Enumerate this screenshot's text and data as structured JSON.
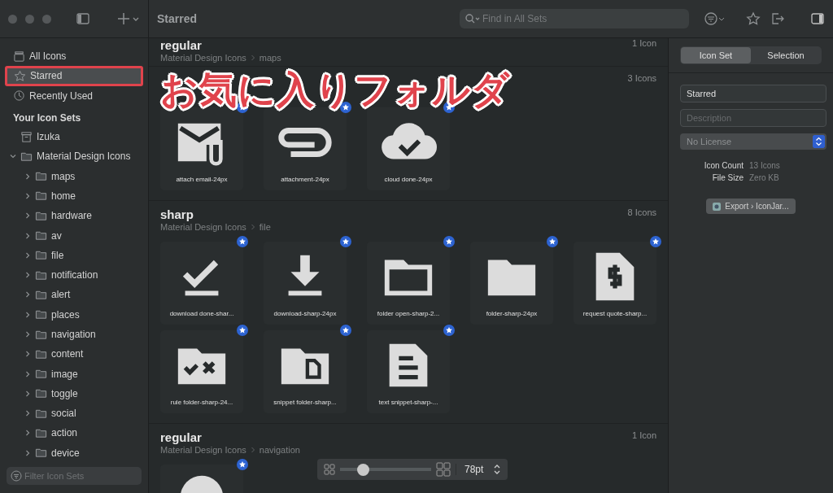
{
  "toolbar": {
    "title": "Starred",
    "search": {
      "placeholder": "Find in All Sets"
    }
  },
  "sidebar": {
    "library": [
      {
        "label": "All Icons",
        "kind": "all",
        "selected": false,
        "highlighted": false
      },
      {
        "label": "Starred",
        "kind": "star",
        "selected": true,
        "highlighted": true
      },
      {
        "label": "Recently Used",
        "kind": "recent",
        "selected": false,
        "highlighted": false
      }
    ],
    "heading": "Your Icon Sets",
    "sets": [
      {
        "label": "Izuka",
        "kind": "box"
      },
      {
        "label": "Material Design Icons",
        "kind": "folder",
        "expanded": true,
        "children": [
          {
            "label": "maps",
            "kind": "folder",
            "expanded": false
          },
          {
            "label": "home",
            "kind": "folder",
            "expanded": false
          },
          {
            "label": "hardware",
            "kind": "folder",
            "expanded": false
          },
          {
            "label": "av",
            "kind": "folder",
            "expanded": false
          },
          {
            "label": "file",
            "kind": "folder",
            "expanded": false
          },
          {
            "label": "notification",
            "kind": "folder",
            "expanded": false
          },
          {
            "label": "alert",
            "kind": "folder",
            "expanded": false
          },
          {
            "label": "places",
            "kind": "folder",
            "expanded": false
          },
          {
            "label": "navigation",
            "kind": "folder",
            "expanded": false
          },
          {
            "label": "content",
            "kind": "folder",
            "expanded": false
          },
          {
            "label": "image",
            "kind": "folder",
            "expanded": false
          },
          {
            "label": "toggle",
            "kind": "folder",
            "expanded": false
          },
          {
            "label": "social",
            "kind": "folder",
            "expanded": false
          },
          {
            "label": "action",
            "kind": "folder",
            "expanded": false
          },
          {
            "label": "device",
            "kind": "folder",
            "expanded": false
          }
        ]
      }
    ],
    "filter": {
      "placeholder": "Filter Icon Sets"
    }
  },
  "sections": [
    {
      "title": "regular",
      "path": [
        "Material Design Icons",
        "maps"
      ],
      "count": "1 Icon"
    },
    {
      "count": "3 Icons",
      "icons": [
        {
          "label": "attach email-24px",
          "kind": "mail-clip",
          "starred": true
        },
        {
          "label": "attachment-24px",
          "kind": "clip",
          "starred": true
        },
        {
          "label": "cloud done-24px",
          "kind": "cloud-check",
          "starred": true
        }
      ]
    },
    {
      "title": "sharp",
      "path": [
        "Material Design Icons",
        "file"
      ],
      "count": "8 Icons",
      "icons": [
        {
          "label": "download done-shar...",
          "kind": "download-done",
          "starred": true
        },
        {
          "label": "download-sharp-24px",
          "kind": "download",
          "starred": true
        },
        {
          "label": "folder open-sharp-2...",
          "kind": "folder-open",
          "starred": true
        },
        {
          "label": "folder-sharp-24px",
          "kind": "folder",
          "starred": true
        },
        {
          "label": "request quote-sharp...",
          "kind": "quote",
          "starred": true
        },
        {
          "label": "rule folder-sharp-24...",
          "kind": "rule-folder",
          "starred": true
        },
        {
          "label": "snippet folder-sharp...",
          "kind": "snippet-folder",
          "starred": true
        },
        {
          "label": "text snippet-sharp-...",
          "kind": "text-snippet",
          "starred": true
        }
      ]
    },
    {
      "title": "regular",
      "path": [
        "Material Design Icons",
        "navigation"
      ],
      "count": "1 Icon",
      "icons": [
        {
          "kind": "circle",
          "starred": true
        }
      ]
    }
  ],
  "zoom": {
    "level": 0.25,
    "value": "78pt"
  },
  "inspector": {
    "tabs": [
      {
        "label": "Icon Set",
        "selected": true
      },
      {
        "label": "Selection",
        "selected": false
      }
    ],
    "name": "Starred",
    "description_placeholder": "Description",
    "license": "No License",
    "info": [
      {
        "key": "Icon Count",
        "value": "13 Icons"
      },
      {
        "key": "File Size",
        "value": "Zero KB"
      }
    ],
    "export": "Export › IconJar..."
  },
  "annotation": {
    "text": "お気に入りフォルダ"
  }
}
